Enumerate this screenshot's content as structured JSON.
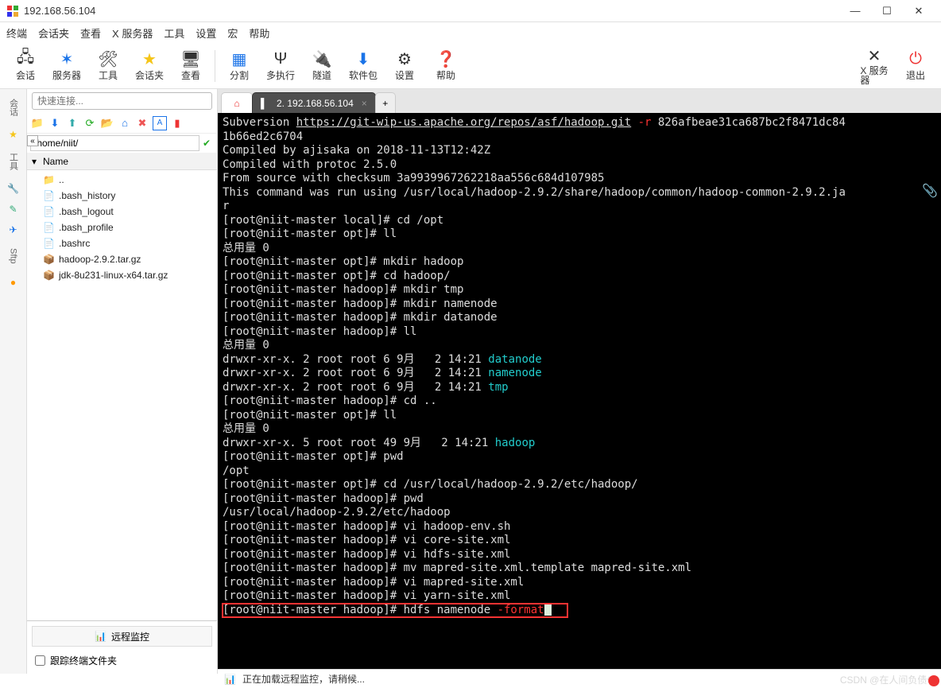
{
  "window": {
    "title": "192.168.56.104",
    "controls": {
      "min": "—",
      "max": "☐",
      "close": "✕"
    }
  },
  "menu": [
    "终端",
    "会话夹",
    "查看",
    "X 服务器",
    "工具",
    "设置",
    "宏",
    "帮助"
  ],
  "toolbar": {
    "session": "会话",
    "server": "服务器",
    "tools": "工具",
    "sessions_folder": "会话夹",
    "view": "查看",
    "split": "分割",
    "multi_exec": "多执行",
    "tunnel": "隧道",
    "packages": "软件包",
    "settings": "设置",
    "help": "帮助",
    "xserver": "X 服务\n器",
    "exit": "退出"
  },
  "quick_connect_placeholder": "快速连接...",
  "collapse": "«",
  "file_path": "/home/niit/",
  "file_header": {
    "arrow": "▾",
    "name": "Name"
  },
  "files": [
    {
      "icon": "📁",
      "name": ".."
    },
    {
      "icon": "📄",
      "name": ".bash_history"
    },
    {
      "icon": "📄",
      "name": ".bash_logout"
    },
    {
      "icon": "📄",
      "name": ".bash_profile"
    },
    {
      "icon": "📄",
      "name": ".bashrc"
    },
    {
      "icon": "📦",
      "name": "hadoop-2.9.2.tar.gz"
    },
    {
      "icon": "📦",
      "name": "jdk-8u231-linux-x64.tar.gz"
    }
  ],
  "remote_monitor_label": "远程监控",
  "follow_folder_label": "跟踪终端文件夹",
  "vtabs": {
    "sessions": "会话",
    "tools": "工具",
    "sftp": "Sftp"
  },
  "tabs": {
    "home_icon": "⌂",
    "active_label": "2. 192.168.56.104",
    "plus": "+"
  },
  "terminal_lines": [
    {
      "segments": [
        {
          "t": "Subversion "
        },
        {
          "t": "https://git-wip-us.apache.org/repos/asf/hadoop.git",
          "u": true
        },
        {
          "t": " "
        },
        {
          "t": "-r",
          "c": "red"
        },
        {
          "t": " 826afbeae31ca687bc2f8471dc84"
        }
      ]
    },
    {
      "segments": [
        {
          "t": "1b66ed2c6704"
        }
      ]
    },
    {
      "segments": [
        {
          "t": "Compiled by ajisaka on 2018-11-13T12:42Z"
        }
      ]
    },
    {
      "segments": [
        {
          "t": "Compiled with protoc 2.5.0"
        }
      ]
    },
    {
      "segments": [
        {
          "t": "From source with checksum 3a9939967262218aa556c684d107985"
        }
      ]
    },
    {
      "segments": [
        {
          "t": "This command was run using /usr/local/hadoop-2.9.2/share/hadoop/common/hadoop-common-2.9.2.ja"
        }
      ]
    },
    {
      "segments": [
        {
          "t": "r"
        }
      ]
    },
    {
      "segments": [
        {
          "t": "[root@niit-master local]# cd /opt"
        }
      ]
    },
    {
      "segments": [
        {
          "t": "[root@niit-master opt]# ll"
        }
      ]
    },
    {
      "segments": [
        {
          "t": "总用量 0"
        }
      ]
    },
    {
      "segments": [
        {
          "t": "[root@niit-master opt]# mkdir hadoop"
        }
      ]
    },
    {
      "segments": [
        {
          "t": "[root@niit-master opt]# cd hadoop/"
        }
      ]
    },
    {
      "segments": [
        {
          "t": "[root@niit-master hadoop]# mkdir tmp"
        }
      ]
    },
    {
      "segments": [
        {
          "t": "[root@niit-master hadoop]# mkdir namenode"
        }
      ]
    },
    {
      "segments": [
        {
          "t": "[root@niit-master hadoop]# mkdir datanode"
        }
      ]
    },
    {
      "segments": [
        {
          "t": "[root@niit-master hadoop]# ll"
        }
      ]
    },
    {
      "segments": [
        {
          "t": "总用量 0"
        }
      ]
    },
    {
      "segments": [
        {
          "t": "drwxr-xr-x. 2 root root 6 9月   2 14:21 "
        },
        {
          "t": "datanode",
          "c": "cyan"
        }
      ]
    },
    {
      "segments": [
        {
          "t": "drwxr-xr-x. 2 root root 6 9月   2 14:21 "
        },
        {
          "t": "namenode",
          "c": "cyan"
        }
      ]
    },
    {
      "segments": [
        {
          "t": "drwxr-xr-x. 2 root root 6 9月   2 14:21 "
        },
        {
          "t": "tmp",
          "c": "cyan"
        }
      ]
    },
    {
      "segments": [
        {
          "t": "[root@niit-master hadoop]# cd .."
        }
      ]
    },
    {
      "segments": [
        {
          "t": "[root@niit-master opt]# ll"
        }
      ]
    },
    {
      "segments": [
        {
          "t": "总用量 0"
        }
      ]
    },
    {
      "segments": [
        {
          "t": "drwxr-xr-x. 5 root root 49 9月   2 14:21 "
        },
        {
          "t": "hadoop",
          "c": "cyan"
        }
      ]
    },
    {
      "segments": [
        {
          "t": "[root@niit-master opt]# pwd"
        }
      ]
    },
    {
      "segments": [
        {
          "t": "/opt"
        }
      ]
    },
    {
      "segments": [
        {
          "t": "[root@niit-master opt]# cd /usr/local/hadoop-2.9.2/etc/hadoop/"
        }
      ]
    },
    {
      "segments": [
        {
          "t": "[root@niit-master hadoop]# pwd"
        }
      ]
    },
    {
      "segments": [
        {
          "t": "/usr/local/hadoop-2.9.2/etc/hadoop"
        }
      ]
    },
    {
      "segments": [
        {
          "t": "[root@niit-master hadoop]# vi hadoop-env.sh"
        }
      ]
    },
    {
      "segments": [
        {
          "t": "[root@niit-master hadoop]# vi core-site.xml"
        }
      ]
    },
    {
      "segments": [
        {
          "t": "[root@niit-master hadoop]# vi hdfs-site.xml"
        }
      ]
    },
    {
      "segments": [
        {
          "t": "[root@niit-master hadoop]# mv mapred-site.xml.template mapred-site.xml"
        }
      ]
    },
    {
      "segments": [
        {
          "t": "[root@niit-master hadoop]# vi mapred-site.xml"
        }
      ]
    },
    {
      "segments": [
        {
          "t": "[root@niit-master hadoop]# vi yarn-site.xml"
        }
      ]
    },
    {
      "segments": [
        {
          "t": "[root@niit-master hadoop]# hdfs namenode "
        },
        {
          "t": "-format",
          "c": "red"
        }
      ],
      "hl": true,
      "cursor": true
    }
  ],
  "status_bar": "正在加载远程监控，请稍候...",
  "watermark": "CSDN @在人间负债^"
}
